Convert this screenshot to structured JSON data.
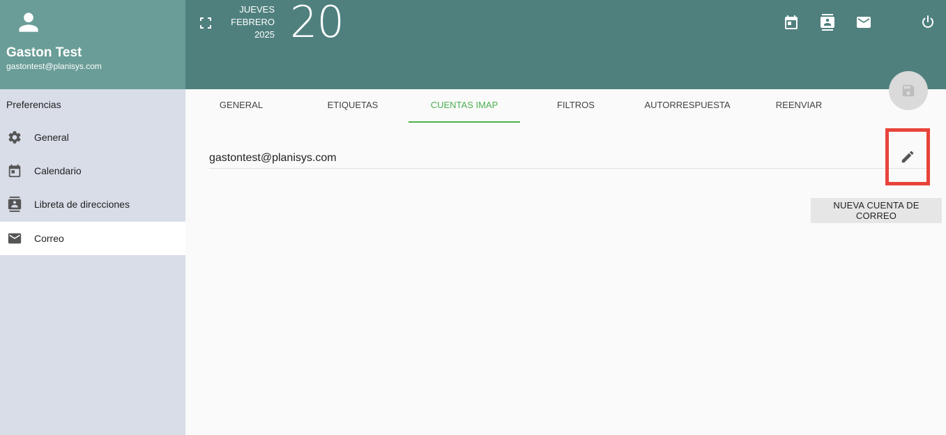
{
  "user": {
    "name": "Gaston Test",
    "email": "gastontest@planisys.com"
  },
  "date": {
    "weekday": "JUEVES",
    "month": "FEBRERO",
    "year": "2025",
    "day": "20"
  },
  "sidebar": {
    "title": "Preferencias",
    "items": [
      {
        "label": "General",
        "icon": "gear-icon"
      },
      {
        "label": "Calendario",
        "icon": "calendar-icon"
      },
      {
        "label": "Libreta de direcciones",
        "icon": "contacts-icon"
      },
      {
        "label": "Correo",
        "icon": "mail-icon",
        "active": true
      }
    ]
  },
  "tabs": [
    {
      "label": "GENERAL"
    },
    {
      "label": "ETIQUETAS"
    },
    {
      "label": "CUENTAS IMAP",
      "active": true
    },
    {
      "label": "FILTROS"
    },
    {
      "label": "AUTORRESPUESTA"
    },
    {
      "label": "REENVIAR"
    }
  ],
  "account": {
    "email": "gastontest@planisys.com"
  },
  "buttons": {
    "new_account": "NUEVA CUENTA DE CORREO"
  },
  "colors": {
    "header_left": "#6a9d97",
    "header_right": "#4f807e",
    "sidebar_bg": "#d8dde8",
    "accent": "#4caf50",
    "highlight": "#e8443a"
  }
}
